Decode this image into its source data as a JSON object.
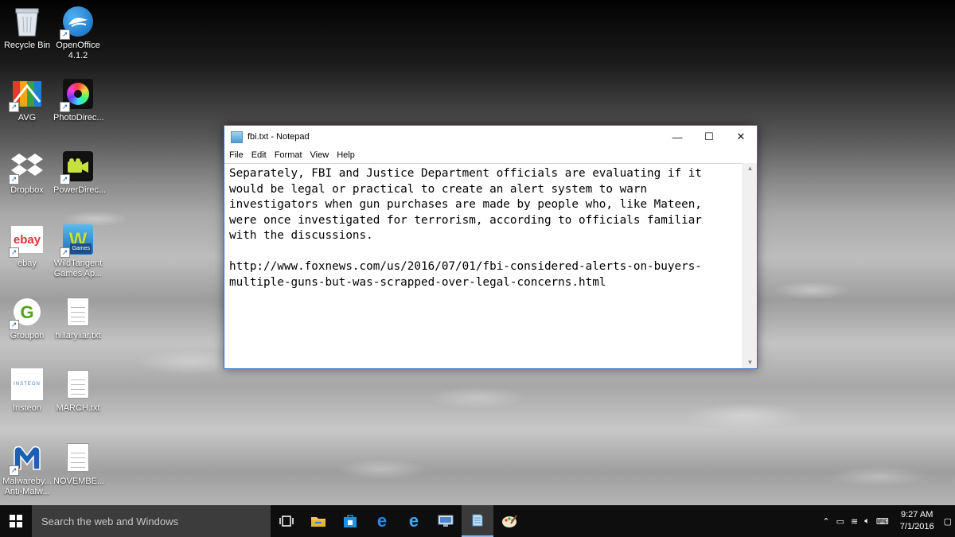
{
  "desktop": {
    "icons": [
      {
        "label": "Recycle Bin"
      },
      {
        "label": "OpenOffice 4.1.2"
      },
      {
        "label": "AVG"
      },
      {
        "label": "PhotoDirec..."
      },
      {
        "label": "Dropbox"
      },
      {
        "label": "PowerDirec..."
      },
      {
        "label": "ebay"
      },
      {
        "label": "WildTangent Games Ap..."
      },
      {
        "label": "Groupon"
      },
      {
        "label": "hillaryliar.txt"
      },
      {
        "label": "Insteon"
      },
      {
        "label": "MARCH.txt"
      },
      {
        "label": "Malwareby... Anti-Malw..."
      },
      {
        "label": "NOVEMBE..."
      }
    ],
    "icon_text": {
      "ebay": "ebay",
      "games": "Games",
      "insteon": "INSTEON",
      "groupon": "G"
    }
  },
  "notepad": {
    "title": "fbi.txt - Notepad",
    "menu": [
      "File",
      "Edit",
      "Format",
      "View",
      "Help"
    ],
    "content": "Separately, FBI and Justice Department officials are evaluating if it\nwould be legal or practical to create an alert system to warn\ninvestigators when gun purchases are made by people who, like Mateen,\nwere once investigated for terrorism, according to officials familiar\nwith the discussions.\n\nhttp://www.foxnews.com/us/2016/07/01/fbi-considered-alerts-on-buyers-\nmultiple-guns-but-was-scrapped-over-legal-concerns.html",
    "buttons": {
      "minimize": "—",
      "maximize": "☐",
      "close": "✕"
    }
  },
  "taskbar": {
    "search_placeholder": "Search the web and Windows",
    "time": "9:27 AM",
    "date": "7/1/2016",
    "apps": [
      "task-view",
      "file-explorer",
      "store",
      "edge",
      "internet-explorer",
      "remote-desktop",
      "notepad",
      "paint"
    ]
  }
}
